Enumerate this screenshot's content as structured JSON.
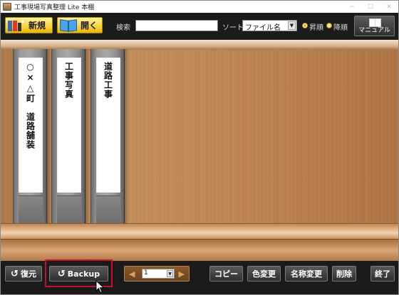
{
  "window": {
    "title": "工事現場写真整理 Lite 本棚",
    "controls": [
      "─",
      "☐",
      "✕"
    ]
  },
  "toolbar": {
    "new_label": "新規",
    "open_label": "開く",
    "search_label": "検索",
    "search_value": "",
    "sort_label": "ソート",
    "sort_value": "ファイル名",
    "ascending_label": "昇順",
    "descending_label": "降順",
    "order_selected": "ascending",
    "manual_label": "マニュアル"
  },
  "shelf": {
    "binders": [
      {
        "label": "○×△町　道路舗装"
      },
      {
        "label": "工事写真"
      },
      {
        "label": "道路工事"
      }
    ]
  },
  "bottombar": {
    "restore_label": "復元",
    "backup_label": "Backup",
    "page_value": "1",
    "copy_label": "コピー",
    "color_change_label": "色変更",
    "rename_label": "名称変更",
    "delete_label": "削除",
    "exit_label": "終了"
  },
  "colors": {
    "accent_yellow": "#f7d437",
    "highlight_red": "#c9102a",
    "dark_bar": "#1b1b1b"
  }
}
